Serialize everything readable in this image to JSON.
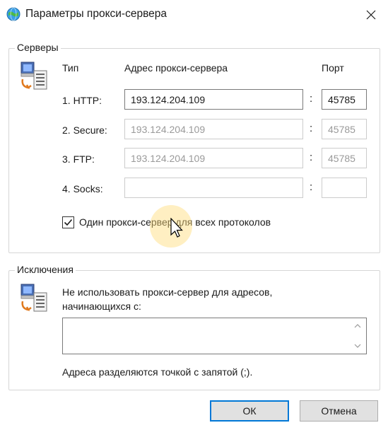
{
  "window": {
    "title": "Параметры прокси-сервера",
    "close_symbol": "✕"
  },
  "servers": {
    "legend": "Серверы",
    "icon": "network-computer-icon",
    "col_type": "Тип",
    "col_address": "Адрес прокси-сервера",
    "col_port": "Порт",
    "rows": [
      {
        "label": "1. HTTP:",
        "address": "193.124.204.109",
        "port": "45785",
        "enabled": true
      },
      {
        "label": "2. Secure:",
        "address": "193.124.204.109",
        "port": "45785",
        "enabled": false
      },
      {
        "label": "3. FTP:",
        "address": "193.124.204.109",
        "port": "45785",
        "enabled": false
      },
      {
        "label": "4. Socks:",
        "address": "",
        "port": "",
        "enabled": false
      }
    ],
    "colon": ":",
    "same_proxy_label": "Один прокси-сервер для всех протоколов",
    "same_proxy_checked": true
  },
  "exceptions": {
    "legend": "Исключения",
    "icon": "network-computer-icon",
    "description": "Не использовать прокси-сервер для адресов, начинающихся с:",
    "value": "",
    "hint": "Адреса разделяются точкой с запятой (;)."
  },
  "buttons": {
    "ok": "ОК",
    "cancel": "Отмена"
  },
  "colors": {
    "accent": "#0078d7",
    "check": "#1a1a1a"
  }
}
